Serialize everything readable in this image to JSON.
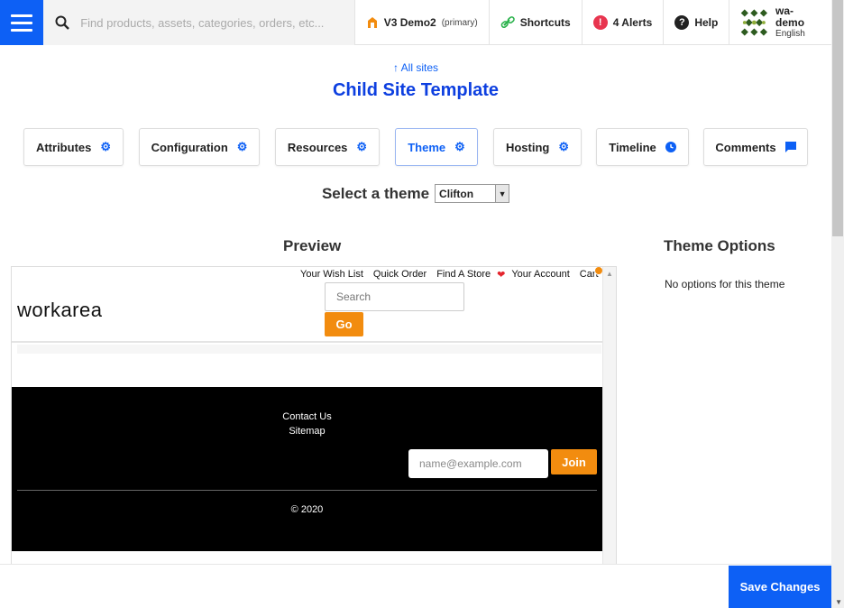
{
  "topbar": {
    "search_placeholder": "Find products, assets, categories, orders, etc...",
    "site_name": "V3 Demo2",
    "site_tag": "(primary)",
    "shortcuts_label": "Shortcuts",
    "alerts_label": "4 Alerts",
    "alerts_icon_text": "!",
    "help_label": "Help",
    "help_icon_text": "?",
    "user_name": "wa-demo",
    "user_lang": "English"
  },
  "breadcrumb": "↑ All sites",
  "page_title": "Child Site Template",
  "tabs": [
    {
      "label": "Attributes",
      "icon": "gear-icon"
    },
    {
      "label": "Configuration",
      "icon": "gear-icon"
    },
    {
      "label": "Resources",
      "icon": "gear-icon"
    },
    {
      "label": "Theme",
      "icon": "gear-icon",
      "active": true
    },
    {
      "label": "Hosting",
      "icon": "gear-icon"
    },
    {
      "label": "Timeline",
      "icon": "clock-icon"
    },
    {
      "label": "Comments",
      "icon": "comment-icon"
    }
  ],
  "theme_select": {
    "label": "Select a theme",
    "value": "Clifton"
  },
  "preview": {
    "heading": "Preview",
    "links": [
      "Your Wish List",
      "Quick Order",
      "Find A Store",
      "Your Account",
      "Cart"
    ],
    "logo": "workarea",
    "search_placeholder": "Search",
    "go_label": "Go",
    "footer_links": [
      "Contact Us",
      "Sitemap"
    ],
    "email_placeholder": "name@example.com",
    "join_label": "Join",
    "copyright": "© 2020"
  },
  "theme_options": {
    "heading": "Theme Options",
    "empty_text": "No options for this theme"
  },
  "save_label": "Save Changes",
  "colors": {
    "primary": "#0d60f5",
    "accent_orange": "#f28c0f",
    "alert_red": "#e8354f"
  }
}
